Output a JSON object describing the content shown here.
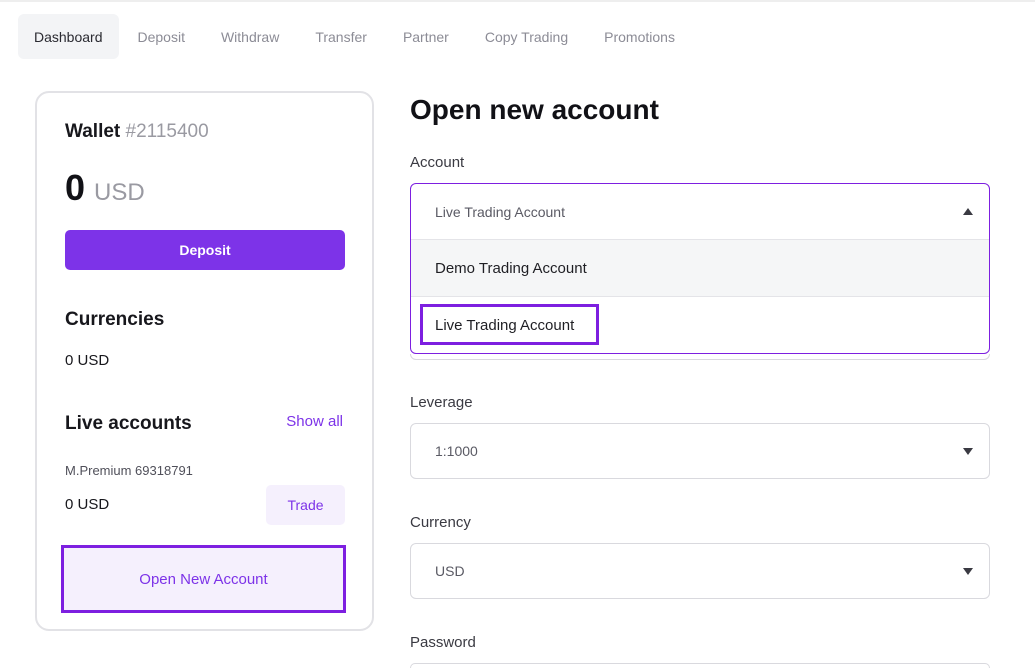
{
  "tabs": [
    {
      "label": "Dashboard",
      "active": true
    },
    {
      "label": "Deposit"
    },
    {
      "label": "Withdraw"
    },
    {
      "label": "Transfer"
    },
    {
      "label": "Partner"
    },
    {
      "label": "Copy Trading"
    },
    {
      "label": "Promotions"
    }
  ],
  "wallet": {
    "title": "Wallet",
    "number": "#2115400",
    "balance": "0",
    "currency": "USD",
    "deposit_label": "Deposit"
  },
  "currencies": {
    "title": "Currencies",
    "value": "0 USD"
  },
  "live_accounts": {
    "title": "Live accounts",
    "show_all": "Show all",
    "account_name": "M.Premium 69318791",
    "account_balance": "0 USD",
    "trade_label": "Trade",
    "open_new_label": "Open New Account"
  },
  "form": {
    "title": "Open new account",
    "account_label": "Account",
    "account_selected": "Live Trading Account",
    "account_options": [
      "Demo Trading Account",
      "Live Trading Account"
    ],
    "leverage_label": "Leverage",
    "leverage_value": "1:1000",
    "currency_label": "Currency",
    "currency_value": "USD",
    "password_label": "Password"
  },
  "colors": {
    "accent": "#7d33e8",
    "highlight": "#7d1fe0"
  }
}
